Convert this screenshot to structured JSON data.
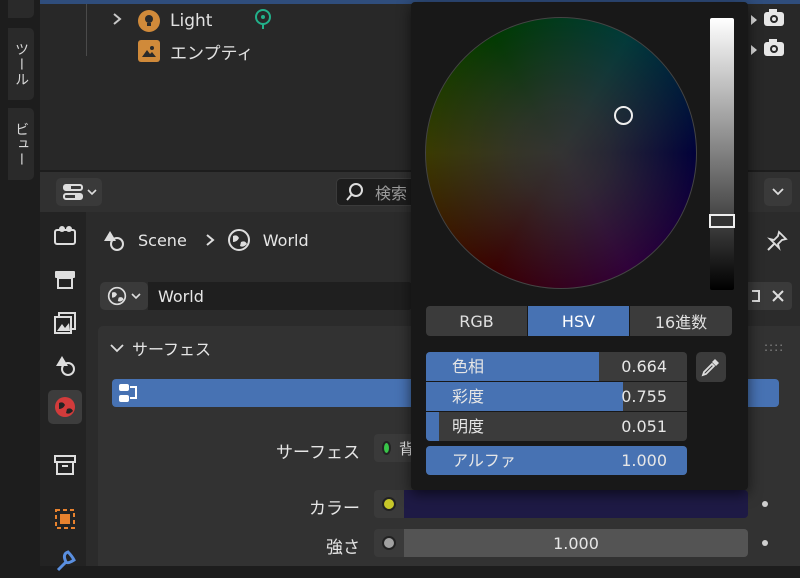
{
  "side_tabs": {
    "tool": "ツール",
    "view": "ビュー"
  },
  "outliner": {
    "items": [
      {
        "label": "Light"
      },
      {
        "label": "エンプティ"
      }
    ]
  },
  "properties": {
    "search_placeholder": "検索",
    "breadcrumb": {
      "scene": "Scene",
      "world": "World"
    },
    "world_name": "World",
    "panel_title": "サーフェス",
    "rows": {
      "surface_label": "サーフェス",
      "surface_value": "背",
      "color_label": "カラー",
      "strength_label": "強さ",
      "strength_value": "1.000"
    },
    "colors": {
      "color_swatch": "#1e1a45",
      "accent": "#4772b3"
    }
  },
  "color_picker": {
    "modes": [
      "RGB",
      "HSV",
      "16進数"
    ],
    "active_mode": "HSV",
    "sliders": [
      {
        "label": "色相",
        "value": "0.664",
        "fraction": 0.664
      },
      {
        "label": "彩度",
        "value": "0.755",
        "fraction": 0.755
      },
      {
        "label": "明度",
        "value": "0.051",
        "fraction": 0.051
      },
      {
        "label": "アルファ",
        "value": "1.000",
        "fraction": 1.0
      }
    ]
  }
}
